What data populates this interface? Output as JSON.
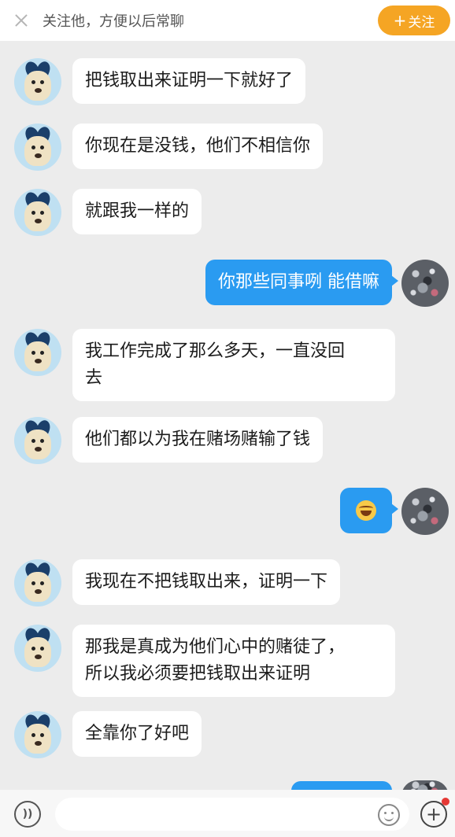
{
  "topbar": {
    "hint": "关注他，方便以后常聊",
    "follow_plus": "+",
    "follow_label": "关注",
    "close_icon": "close-icon"
  },
  "messages": [
    {
      "from": "them",
      "text": "把钱取出来证明一下就好了"
    },
    {
      "from": "them",
      "text": "你现在是没钱，他们不相信你"
    },
    {
      "from": "them",
      "text": "就跟我一样的"
    },
    {
      "from": "me",
      "text": "你那些同事咧 能借嘛"
    },
    {
      "from": "them",
      "line1": "我工作完成了那么多天，一直没回",
      "line2": "去"
    },
    {
      "from": "them",
      "text": "他们都以为我在赌场赌输了钱"
    },
    {
      "from": "me",
      "emoji": "laughing-emoji"
    },
    {
      "from": "them",
      "text": "我现在不把钱取出来，证明一下"
    },
    {
      "from": "them",
      "line1": "那我是真成为他们心中的赌徒了，",
      "line2": "所以我必须要把钱取出来证明"
    },
    {
      "from": "them",
      "text": "全靠你了好吧"
    }
  ],
  "colors": {
    "background": "#ececec",
    "outgoing_bubble": "#2a9bf1",
    "incoming_bubble": "#ffffff",
    "follow_button": "#f5a524"
  },
  "bottombar": {
    "voice_icon": "voice-icon",
    "voice_glyph": "))",
    "emoji_icon": "smile-icon",
    "plus_icon": "plus-icon",
    "plus_glyph": "+"
  }
}
